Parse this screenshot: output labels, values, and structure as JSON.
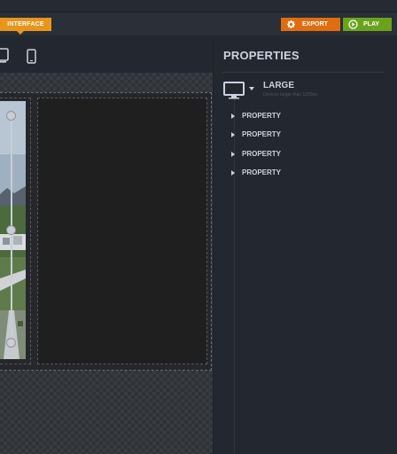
{
  "topbar": {
    "interface_tab": "INTERFACE",
    "export_label": "EXPORT",
    "play_label": "PLAY"
  },
  "devices": [
    "desktop-icon",
    "mobile-icon"
  ],
  "properties_panel": {
    "title": "PROPERTIES",
    "size_title": "LARGE",
    "size_description": "Devices larger than 1200px",
    "items": [
      "PROPERTY",
      "PROPERTY",
      "PROPERTY",
      "PROPERTY"
    ]
  },
  "colors": {
    "interface_tab": "#e8951b",
    "export_button": "#e06d10",
    "play_button": "#6aa31b",
    "panel_bg": "#232830"
  }
}
